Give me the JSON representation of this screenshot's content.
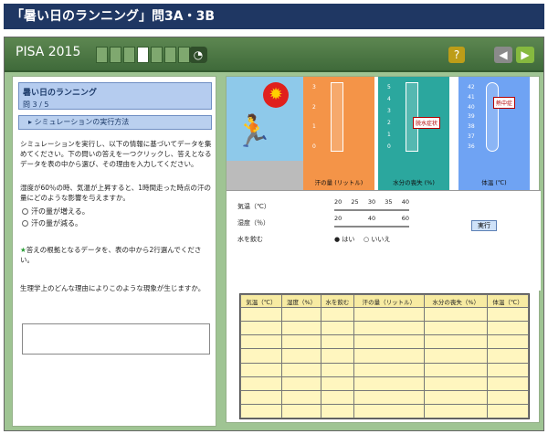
{
  "page_title": "「暑い日のランニング」問3A・3B",
  "app": {
    "brand": "PISA 2015",
    "progress_boxes": [
      false,
      false,
      false,
      true,
      false,
      false,
      false
    ],
    "help_icon": "question-icon",
    "prev_icon": "left-arrow-icon",
    "next_icon": "right-arrow-icon"
  },
  "left_panel": {
    "title": "暑い日のランニング",
    "question_number": "問 3 / 5",
    "section_header": "シミュレーションの実行方法",
    "intro": "シミュレーションを実行し、以下の情報に基づいてデータを集めてください。下の問いの答えを一つクリックし、答えとなるデータを表の中から選び、その理由を入力してください。",
    "question": "湿度が60％の時、気温が上昇すると、1時間走った時点の汗の量にどのような影響を与えますか。",
    "option_1": "汗の量が増える。",
    "option_2": "汗の量が減る。",
    "select_instruction": "答えの根拠となるデータを、表の中から2行選んでください。",
    "reason_prompt": "生理学上のどんな理由によりこのような現象が生じますか。"
  },
  "simulation": {
    "sweat_label": "汗の量\n(リットル)",
    "water_label": "水分の喪失\n(%)",
    "temp_label": "体温\n(℃)",
    "dehydration_callout": "脱水症状",
    "heatstroke_callout": "熱中症",
    "sweat_ticks": [
      "3",
      "2",
      "1",
      "0"
    ],
    "water_ticks": [
      "5",
      "4",
      "3",
      "2",
      "1",
      "0"
    ],
    "temp_ticks": [
      "42",
      "41",
      "40",
      "39",
      "38",
      "37",
      "36"
    ]
  },
  "controls": {
    "temp_label": "気温（℃）",
    "humidity_label": "湿度（％）",
    "drink_label": "水を飲む",
    "temp_values": [
      "20",
      "25",
      "30",
      "35",
      "40"
    ],
    "humidity_values": [
      "20",
      "40",
      "60"
    ],
    "drink_yes": "はい",
    "drink_no": "いいえ",
    "run_button": "実行"
  },
  "table": {
    "headers": [
      "気温（℃）",
      "湿度（%）",
      "水を飲む",
      "汗の量（リットル）",
      "水分の喪失（%）",
      "体温（℃）"
    ]
  },
  "colors": {
    "header": "#1f3763",
    "sweat": "#f49448",
    "water": "#2ba79e",
    "temp": "#6fa3f3"
  }
}
